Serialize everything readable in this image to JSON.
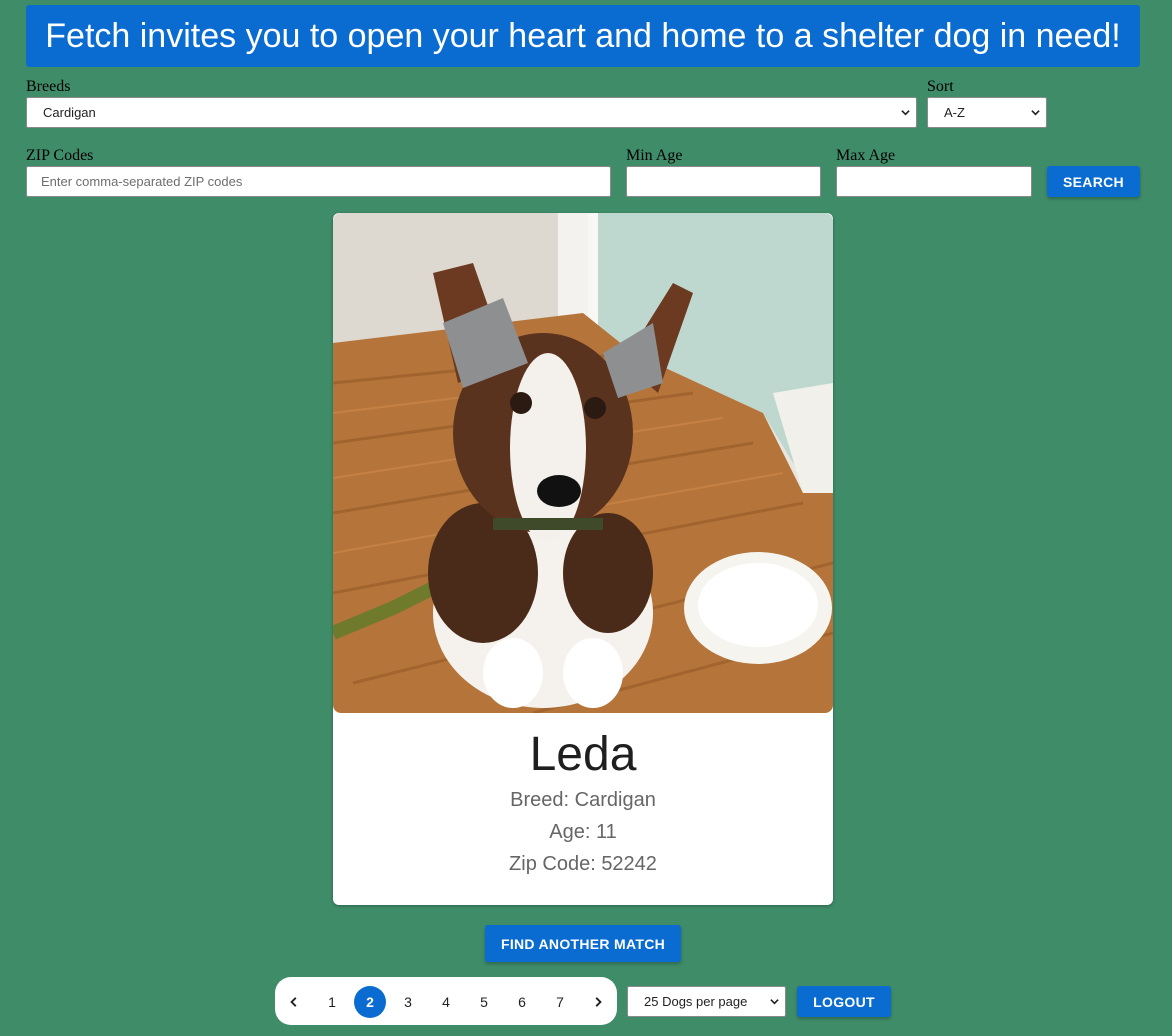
{
  "banner": {
    "text": "Fetch invites you to open your heart and home to a shelter dog in need!"
  },
  "filters": {
    "breeds": {
      "label": "Breeds",
      "value": "Cardigan"
    },
    "sort": {
      "label": "Sort",
      "value": "A-Z"
    },
    "zip": {
      "label": "ZIP Codes",
      "value": "",
      "placeholder": "Enter comma-separated ZIP codes"
    },
    "min_age": {
      "label": "Min Age",
      "value": ""
    },
    "max_age": {
      "label": "Max Age",
      "value": ""
    },
    "search_label": "SEARCH"
  },
  "dog": {
    "name": "Leda",
    "breed": "Breed: Cardigan",
    "age": "Age: 11",
    "zip": "Zip Code: 52242"
  },
  "actions": {
    "find_match_label": "FIND ANOTHER MATCH",
    "logout_label": "LOGOUT"
  },
  "pagination": {
    "pages": [
      "1",
      "2",
      "3",
      "4",
      "5",
      "6",
      "7"
    ],
    "current": "2",
    "prev_icon": "chevron-left-icon",
    "next_icon": "chevron-right-icon",
    "per_page": "25 Dogs per page"
  },
  "colors": {
    "background": "#3f8c69",
    "accent": "#0a6cd1",
    "card": "#ffffff"
  }
}
